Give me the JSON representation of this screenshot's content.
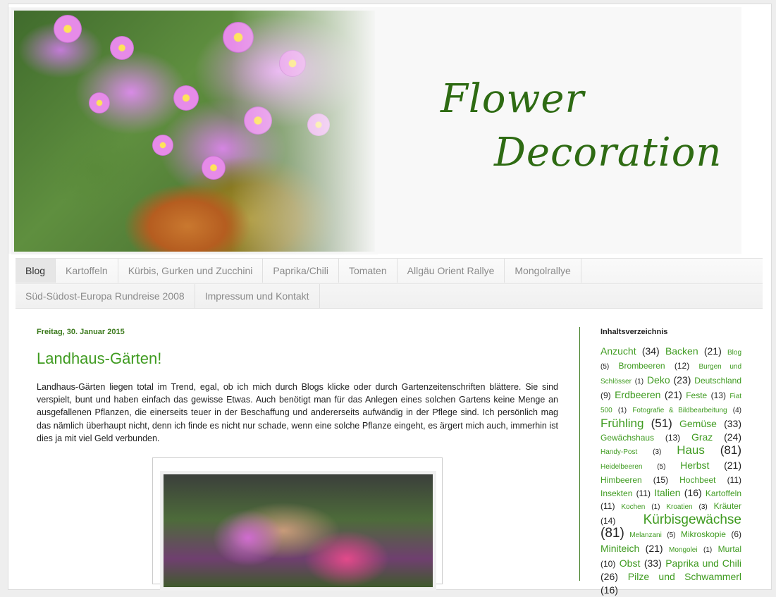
{
  "header": {
    "title_line1": "Flower",
    "title_line2": "Decoration"
  },
  "nav": {
    "row1": [
      "Blog",
      "Kartoffeln",
      "Kürbis, Gurken und Zucchini",
      "Paprika/Chili",
      "Tomaten",
      "Allgäu Orient Rallye",
      "Mongolrallye"
    ],
    "row2": [
      "Süd-Südost-Europa Rundreise 2008",
      "Impressum und Kontakt"
    ]
  },
  "post": {
    "date": "Freitag, 30. Januar 2015",
    "title": "Landhaus-Gärten!",
    "body": "Landhaus-Gärten liegen total im Trend, egal, ob ich mich durch Blogs klicke oder durch Gartenzeitenschriften blättere. Sie sind verspielt, bunt und haben einfach das gewisse Etwas. Auch benötigt man für das Anlegen eines solchen Gartens keine Menge an ausgefallenen Pflanzen, die einerseits teuer in der Beschaffung und andererseits aufwändig in der Pflege sind. Ich persönlich mag das nämlich überhaupt nicht, denn ich finde es nicht nur schade, wenn eine solche Pflanze eingeht, es ärgert mich auch, immerhin ist dies ja mit viel Geld verbunden."
  },
  "sidebar": {
    "heading": "Inhaltsverzeichnis",
    "labels": [
      {
        "name": "Anzucht",
        "count": "(34)",
        "size": 3
      },
      {
        "name": "Backen",
        "count": "(21)",
        "size": 3
      },
      {
        "name": "Blog",
        "count": "(5)",
        "size": 1
      },
      {
        "name": "Brombeeren",
        "count": "(12)",
        "size": 2
      },
      {
        "name": "Burgen und Schlösser",
        "count": "(1)",
        "size": 1
      },
      {
        "name": "Deko",
        "count": "(23)",
        "size": 3
      },
      {
        "name": "Deutschland",
        "count": "(9)",
        "size": 2
      },
      {
        "name": "Erdbeeren",
        "count": "(21)",
        "size": 3
      },
      {
        "name": "Feste",
        "count": "(13)",
        "size": 2
      },
      {
        "name": "Fiat 500",
        "count": "(1)",
        "size": 1
      },
      {
        "name": "Fotografie & Bildbearbeitung",
        "count": "(4)",
        "size": 1
      },
      {
        "name": "Frühling",
        "count": "(51)",
        "size": 4
      },
      {
        "name": "Gemüse",
        "count": "(33)",
        "size": 3
      },
      {
        "name": "Gewächshaus",
        "count": "(13)",
        "size": 2
      },
      {
        "name": "Graz",
        "count": "(24)",
        "size": 3
      },
      {
        "name": "Handy-Post",
        "count": "(3)",
        "size": 1
      },
      {
        "name": "Haus",
        "count": "(81)",
        "size": 4
      },
      {
        "name": "Heidelbeeren",
        "count": "(5)",
        "size": 1
      },
      {
        "name": "Herbst",
        "count": "(21)",
        "size": 3
      },
      {
        "name": "Himbeeren",
        "count": "(15)",
        "size": 2
      },
      {
        "name": "Hochbeet",
        "count": "(11)",
        "size": 2
      },
      {
        "name": "Insekten",
        "count": "(11)",
        "size": 2
      },
      {
        "name": "Italien",
        "count": "(16)",
        "size": 3
      },
      {
        "name": "Kartoffeln",
        "count": "(11)",
        "size": 2
      },
      {
        "name": "Kochen",
        "count": "(1)",
        "size": 1
      },
      {
        "name": "Kroatien",
        "count": "(3)",
        "size": 1
      },
      {
        "name": "Kräuter",
        "count": "(14)",
        "size": 2
      },
      {
        "name": "Kürbisgewächse",
        "count": "(81)",
        "size": 5
      },
      {
        "name": "Melanzani",
        "count": "(5)",
        "size": 1
      },
      {
        "name": "Mikroskopie",
        "count": "(6)",
        "size": 2
      },
      {
        "name": "Miniteich",
        "count": "(21)",
        "size": 3
      },
      {
        "name": "Mongolei",
        "count": "(1)",
        "size": 1
      },
      {
        "name": "Murtal",
        "count": "(10)",
        "size": 2
      },
      {
        "name": "Obst",
        "count": "(33)",
        "size": 3
      },
      {
        "name": "Paprika und Chili",
        "count": "(26)",
        "size": 3
      },
      {
        "name": "Pilze und Schwammerl",
        "count": "(16)",
        "size": 3
      }
    ]
  },
  "colors": {
    "title_green": "#2e6b13",
    "link_green": "#3f9b20",
    "date_green": "#3c7a1d"
  }
}
